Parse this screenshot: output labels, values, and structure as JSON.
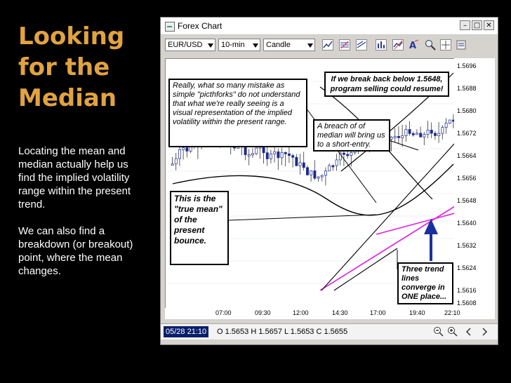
{
  "slide": {
    "title_lines": [
      "Looking",
      "for the",
      "Median"
    ],
    "paragraph1": "Locating the mean and median actually help us find the implied volatility range within the present trend.",
    "paragraph2": "We can also find a breakdown (or breakout) point, where the mean changes."
  },
  "window": {
    "title": "Forex Chart",
    "controls": {
      "minimize": "–",
      "maximize": "□",
      "close": "✕"
    }
  },
  "toolbar": {
    "symbol": "EUR/USD",
    "timeframe": "10-min",
    "chart_style": "Candle"
  },
  "chart": {
    "y_ticks": [
      "1.5696",
      "1.5688",
      "1.5680",
      "1.5672",
      "1.5664",
      "1.5656",
      "1.5648",
      "1.5640",
      "1.5632",
      "1.5624",
      "1.5616",
      "1.5608"
    ],
    "x_ticks": [
      "07:00",
      "09:30",
      "12:00",
      "14:30",
      "17:00",
      "19:40",
      "22:10"
    ]
  },
  "status": {
    "datetime": "05/28 21:10",
    "ohlc": "O 1.5653 H 1.5657 L 1.5653 C 1.5655"
  },
  "annotations": {
    "pitchforks": "Really, what so many mistake as simple \"picthforks\" do not understand that what we're really seeing is a visual representation of the implied volatility within the present range.",
    "program_selling": "If we break back below 1.5648, program selling could resume!",
    "short_entry": "A breach of of median will bring us to a short-entry.",
    "true_mean": "This is the \"true mean\" of the present bounce.",
    "trend_lines": "Three trend lines converge in ONE place..."
  }
}
